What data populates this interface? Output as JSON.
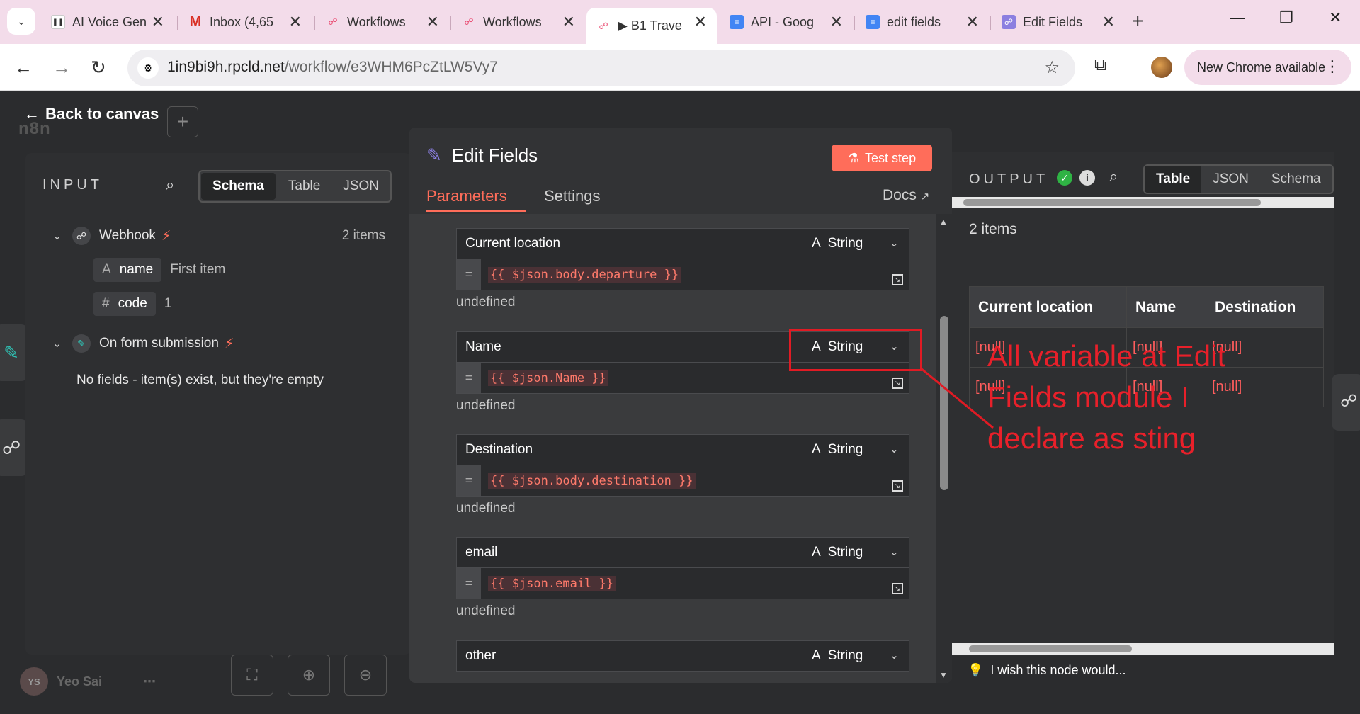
{
  "browser": {
    "tabs": [
      {
        "title": "AI Voice Gen",
        "fav": "pause-icon"
      },
      {
        "title": "Inbox (4,65",
        "fav": "gmail-icon"
      },
      {
        "title": "Workflows",
        "fav": "n8n-icon"
      },
      {
        "title": "Workflows",
        "fav": "n8n-icon"
      },
      {
        "title": "▶ B1 Trave",
        "fav": "n8n-icon"
      },
      {
        "title": "API - Goog",
        "fav": "docs-icon"
      },
      {
        "title": "edit fields",
        "fav": "docs-icon"
      },
      {
        "title": "Edit Fields",
        "fav": "n8n-icon"
      }
    ],
    "url_host": "1in9bi9h.rpcld.net",
    "url_path": "/workflow/e3WHM6PcZtLW5Vy7",
    "new_chrome": "New Chrome available"
  },
  "app": {
    "back_label": "Back to canvas",
    "logo_text": "n8n",
    "user_initials": "YS",
    "user_name": "Yeo Sai"
  },
  "input": {
    "title": "INPUT",
    "views": [
      "Schema",
      "Table",
      "JSON"
    ],
    "active_view": "Schema",
    "webhook_label": "Webhook",
    "webhook_count": "2 items",
    "fields": [
      {
        "icon": "A",
        "key": "name",
        "value": "First item"
      },
      {
        "icon": "#",
        "key": "code",
        "value": "1"
      }
    ],
    "form_label": "On form submission",
    "form_empty": "No fields - item(s) exist, but they're empty"
  },
  "editor": {
    "title": "Edit Fields",
    "test_step": "Test step",
    "tabs": [
      "Parameters",
      "Settings"
    ],
    "docs": "Docs",
    "fields": [
      {
        "name": "Current location",
        "type": "String",
        "value": "{{ $json.body.departure }}",
        "hint": "undefined"
      },
      {
        "name": "Name",
        "type": "String",
        "value": "{{ $json.Name }}",
        "hint": "undefined"
      },
      {
        "name": "Destination",
        "type": "String",
        "value": "{{ $json.body.destination }}",
        "hint": "undefined"
      },
      {
        "name": "email",
        "type": "String",
        "value": "{{ $json.email }}",
        "hint": "undefined"
      },
      {
        "name": "other",
        "type": "String",
        "value": "",
        "hint": ""
      }
    ]
  },
  "output": {
    "title": "OUTPUT",
    "views": [
      "Table",
      "JSON",
      "Schema"
    ],
    "active_view": "Table",
    "count": "2 items",
    "columns": [
      "Current location",
      "Name",
      "Destination"
    ],
    "rows": [
      [
        "[null]",
        "[null]",
        "[null]"
      ],
      [
        "[null]",
        "[null]",
        "[null]"
      ]
    ],
    "wish": "I wish this node would..."
  },
  "annotation": {
    "text": "All variable at Edit Fields module I declare as sting",
    "color": "#e01b24"
  }
}
